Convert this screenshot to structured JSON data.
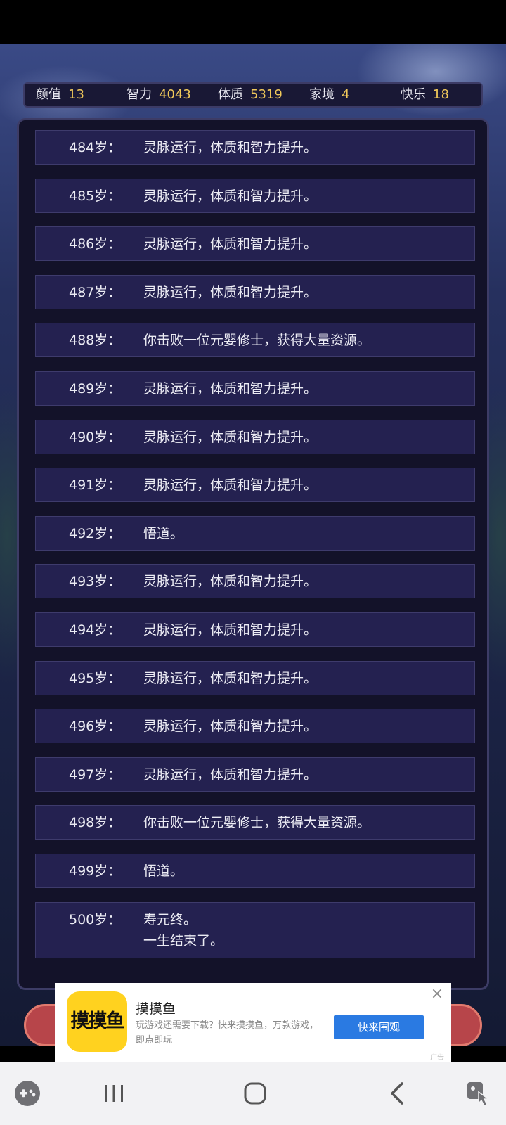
{
  "stats": [
    {
      "label": "颜值",
      "value": "13"
    },
    {
      "label": "智力",
      "value": "4043"
    },
    {
      "label": "体质",
      "value": "5319"
    },
    {
      "label": "家境",
      "value": "4"
    },
    {
      "label": "快乐",
      "value": "18"
    }
  ],
  "log": [
    {
      "age": "484岁：",
      "text": "灵脉运行，体质和智力提升。"
    },
    {
      "age": "485岁：",
      "text": "灵脉运行，体质和智力提升。"
    },
    {
      "age": "486岁：",
      "text": "灵脉运行，体质和智力提升。"
    },
    {
      "age": "487岁：",
      "text": "灵脉运行，体质和智力提升。"
    },
    {
      "age": "488岁：",
      "text": "你击败一位元婴修士，获得大量资源。"
    },
    {
      "age": "489岁：",
      "text": "灵脉运行，体质和智力提升。"
    },
    {
      "age": "490岁：",
      "text": "灵脉运行，体质和智力提升。"
    },
    {
      "age": "491岁：",
      "text": "灵脉运行，体质和智力提升。"
    },
    {
      "age": "492岁：",
      "text": "悟道。"
    },
    {
      "age": "493岁：",
      "text": "灵脉运行，体质和智力提升。"
    },
    {
      "age": "494岁：",
      "text": "灵脉运行，体质和智力提升。"
    },
    {
      "age": "495岁：",
      "text": "灵脉运行，体质和智力提升。"
    },
    {
      "age": "496岁：",
      "text": "灵脉运行，体质和智力提升。"
    },
    {
      "age": "497岁：",
      "text": "灵脉运行，体质和智力提升。"
    },
    {
      "age": "498岁：",
      "text": "你击败一位元婴修士，获得大量资源。"
    },
    {
      "age": "499岁：",
      "text": "悟道。"
    },
    {
      "age": "500岁：",
      "text": "寿元终。",
      "text2": "一生结束了。"
    }
  ],
  "ad": {
    "logo_text": "摸摸鱼",
    "title": "摸摸鱼",
    "description": "玩游戏还需要下载？快来摸摸鱼，万款游戏，即点即玩",
    "cta": "快来围观",
    "close": "×",
    "tag": "广告"
  },
  "nav": {
    "icons": [
      "game-controller-icon",
      "recent-apps-icon",
      "home-icon",
      "back-icon",
      "touch-assistant-icon"
    ]
  }
}
